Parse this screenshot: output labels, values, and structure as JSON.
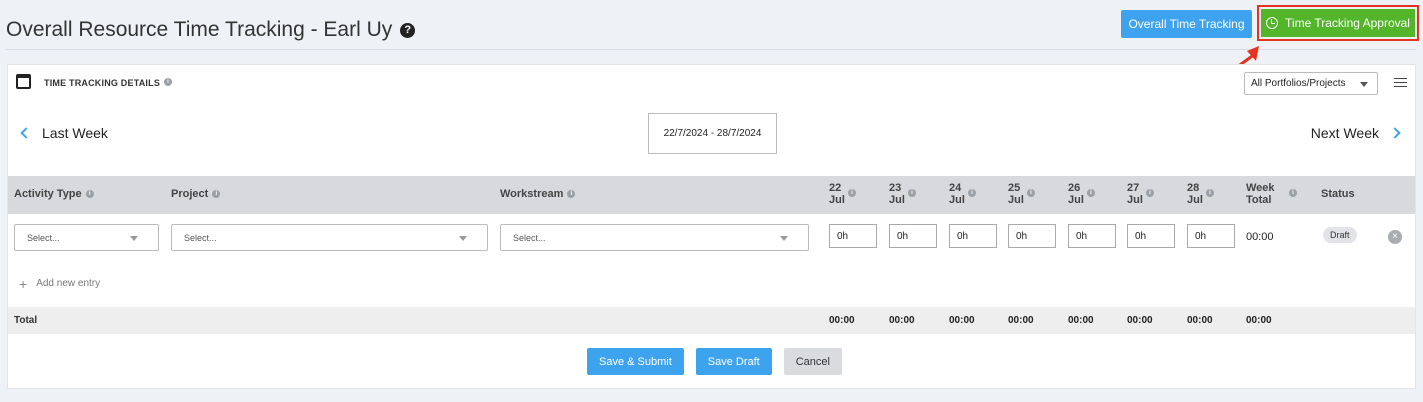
{
  "page": {
    "title": "Overall Resource Time Tracking - Earl Uy",
    "help_icon_glyph": "?"
  },
  "header_buttons": {
    "overall": "Overall Time Tracking",
    "approval": "Time Tracking Approval"
  },
  "details": {
    "title": "TIME TRACKING DETAILS",
    "portfolio_filter": "All Portfolios/Projects"
  },
  "week_nav": {
    "prev": "Last Week",
    "next": "Next Week",
    "range": "22/7/2024 - 28/7/2024"
  },
  "table": {
    "headers": {
      "activity": "Activity Type",
      "project": "Project",
      "workstream": "Workstream",
      "days": [
        {
          "day": "22",
          "month": "Jul"
        },
        {
          "day": "23",
          "month": "Jul"
        },
        {
          "day": "24",
          "month": "Jul"
        },
        {
          "day": "25",
          "month": "Jul"
        },
        {
          "day": "26",
          "month": "Jul"
        },
        {
          "day": "27",
          "month": "Jul"
        },
        {
          "day": "28",
          "month": "Jul"
        }
      ],
      "week_total": [
        "Week",
        "Total"
      ],
      "status": "Status"
    },
    "row": {
      "activity_placeholder": "Select...",
      "project_placeholder": "Select...",
      "workstream_placeholder": "Select...",
      "hours": [
        "0h",
        "0h",
        "0h",
        "0h",
        "0h",
        "0h",
        "0h"
      ],
      "week_total": "00:00",
      "status": "Draft"
    },
    "add_entry": "Add new entry",
    "total_label": "Total",
    "totals": [
      "00:00",
      "00:00",
      "00:00",
      "00:00",
      "00:00",
      "00:00",
      "00:00",
      "00:00"
    ]
  },
  "actions": {
    "submit": "Save & Submit",
    "draft": "Save Draft",
    "cancel": "Cancel"
  },
  "colors": {
    "primary_blue": "#3ea3ee",
    "approval_green": "#52b52a",
    "highlight_red": "#e53321"
  }
}
